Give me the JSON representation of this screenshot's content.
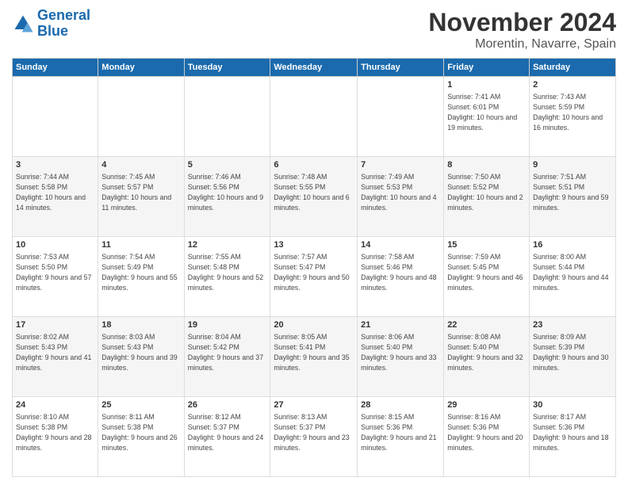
{
  "logo": {
    "line1": "General",
    "line2": "Blue"
  },
  "title": "November 2024",
  "subtitle": "Morentin, Navarre, Spain",
  "days_of_week": [
    "Sunday",
    "Monday",
    "Tuesday",
    "Wednesday",
    "Thursday",
    "Friday",
    "Saturday"
  ],
  "weeks": [
    [
      {
        "day": "",
        "info": ""
      },
      {
        "day": "",
        "info": ""
      },
      {
        "day": "",
        "info": ""
      },
      {
        "day": "",
        "info": ""
      },
      {
        "day": "",
        "info": ""
      },
      {
        "day": "1",
        "info": "Sunrise: 7:41 AM\nSunset: 6:01 PM\nDaylight: 10 hours and 19 minutes."
      },
      {
        "day": "2",
        "info": "Sunrise: 7:43 AM\nSunset: 5:59 PM\nDaylight: 10 hours and 16 minutes."
      }
    ],
    [
      {
        "day": "3",
        "info": "Sunrise: 7:44 AM\nSunset: 5:58 PM\nDaylight: 10 hours and 14 minutes."
      },
      {
        "day": "4",
        "info": "Sunrise: 7:45 AM\nSunset: 5:57 PM\nDaylight: 10 hours and 11 minutes."
      },
      {
        "day": "5",
        "info": "Sunrise: 7:46 AM\nSunset: 5:56 PM\nDaylight: 10 hours and 9 minutes."
      },
      {
        "day": "6",
        "info": "Sunrise: 7:48 AM\nSunset: 5:55 PM\nDaylight: 10 hours and 6 minutes."
      },
      {
        "day": "7",
        "info": "Sunrise: 7:49 AM\nSunset: 5:53 PM\nDaylight: 10 hours and 4 minutes."
      },
      {
        "day": "8",
        "info": "Sunrise: 7:50 AM\nSunset: 5:52 PM\nDaylight: 10 hours and 2 minutes."
      },
      {
        "day": "9",
        "info": "Sunrise: 7:51 AM\nSunset: 5:51 PM\nDaylight: 9 hours and 59 minutes."
      }
    ],
    [
      {
        "day": "10",
        "info": "Sunrise: 7:53 AM\nSunset: 5:50 PM\nDaylight: 9 hours and 57 minutes."
      },
      {
        "day": "11",
        "info": "Sunrise: 7:54 AM\nSunset: 5:49 PM\nDaylight: 9 hours and 55 minutes."
      },
      {
        "day": "12",
        "info": "Sunrise: 7:55 AM\nSunset: 5:48 PM\nDaylight: 9 hours and 52 minutes."
      },
      {
        "day": "13",
        "info": "Sunrise: 7:57 AM\nSunset: 5:47 PM\nDaylight: 9 hours and 50 minutes."
      },
      {
        "day": "14",
        "info": "Sunrise: 7:58 AM\nSunset: 5:46 PM\nDaylight: 9 hours and 48 minutes."
      },
      {
        "day": "15",
        "info": "Sunrise: 7:59 AM\nSunset: 5:45 PM\nDaylight: 9 hours and 46 minutes."
      },
      {
        "day": "16",
        "info": "Sunrise: 8:00 AM\nSunset: 5:44 PM\nDaylight: 9 hours and 44 minutes."
      }
    ],
    [
      {
        "day": "17",
        "info": "Sunrise: 8:02 AM\nSunset: 5:43 PM\nDaylight: 9 hours and 41 minutes."
      },
      {
        "day": "18",
        "info": "Sunrise: 8:03 AM\nSunset: 5:43 PM\nDaylight: 9 hours and 39 minutes."
      },
      {
        "day": "19",
        "info": "Sunrise: 8:04 AM\nSunset: 5:42 PM\nDaylight: 9 hours and 37 minutes."
      },
      {
        "day": "20",
        "info": "Sunrise: 8:05 AM\nSunset: 5:41 PM\nDaylight: 9 hours and 35 minutes."
      },
      {
        "day": "21",
        "info": "Sunrise: 8:06 AM\nSunset: 5:40 PM\nDaylight: 9 hours and 33 minutes."
      },
      {
        "day": "22",
        "info": "Sunrise: 8:08 AM\nSunset: 5:40 PM\nDaylight: 9 hours and 32 minutes."
      },
      {
        "day": "23",
        "info": "Sunrise: 8:09 AM\nSunset: 5:39 PM\nDaylight: 9 hours and 30 minutes."
      }
    ],
    [
      {
        "day": "24",
        "info": "Sunrise: 8:10 AM\nSunset: 5:38 PM\nDaylight: 9 hours and 28 minutes."
      },
      {
        "day": "25",
        "info": "Sunrise: 8:11 AM\nSunset: 5:38 PM\nDaylight: 9 hours and 26 minutes."
      },
      {
        "day": "26",
        "info": "Sunrise: 8:12 AM\nSunset: 5:37 PM\nDaylight: 9 hours and 24 minutes."
      },
      {
        "day": "27",
        "info": "Sunrise: 8:13 AM\nSunset: 5:37 PM\nDaylight: 9 hours and 23 minutes."
      },
      {
        "day": "28",
        "info": "Sunrise: 8:15 AM\nSunset: 5:36 PM\nDaylight: 9 hours and 21 minutes."
      },
      {
        "day": "29",
        "info": "Sunrise: 8:16 AM\nSunset: 5:36 PM\nDaylight: 9 hours and 20 minutes."
      },
      {
        "day": "30",
        "info": "Sunrise: 8:17 AM\nSunset: 5:36 PM\nDaylight: 9 hours and 18 minutes."
      }
    ]
  ]
}
